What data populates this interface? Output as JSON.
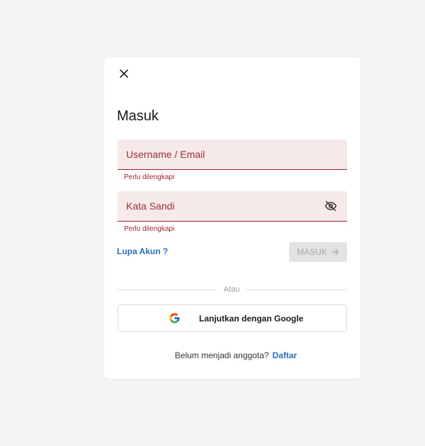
{
  "modal": {
    "title": "Masuk",
    "close_icon": "close-icon"
  },
  "username": {
    "placeholder": "Username / Email",
    "value": "",
    "error": "Perlu dilengkapi"
  },
  "password": {
    "placeholder": "Kata Sandi",
    "value": "",
    "error": "Perlu dilengkapi",
    "toggle_icon": "eye-slash-icon"
  },
  "forgot_link": "Lupa Akun ?",
  "login_button": {
    "label": "MASUK",
    "icon": "arrow-right-icon",
    "disabled": true
  },
  "divider_text": "Atau",
  "google_button": {
    "label": "Lanjutkan dengan Google",
    "icon": "google-icon"
  },
  "register": {
    "prompt": "Belum menjadi anggota?",
    "link": "Daftar"
  },
  "colors": {
    "page_background": "#f4f4f4",
    "field_background": "#f6e9ea",
    "error": "#a3232c",
    "link": "#2d6fb5",
    "disabled_button": "#e2e2e2"
  }
}
